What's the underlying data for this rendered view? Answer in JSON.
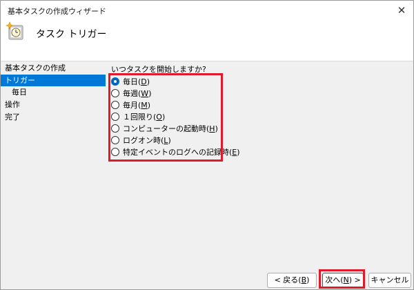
{
  "window": {
    "title": "基本タスクの作成ウィザード",
    "close_glyph": "✕"
  },
  "header": {
    "title": "タスク トリガー",
    "icon": "task-clock-icon"
  },
  "sidebar": {
    "items": [
      {
        "label": "基本タスクの作成",
        "selected": false,
        "sub": false
      },
      {
        "label": "トリガー",
        "selected": true,
        "sub": false
      },
      {
        "label": "毎日",
        "selected": false,
        "sub": true
      },
      {
        "label": "操作",
        "selected": false,
        "sub": false
      },
      {
        "label": "完了",
        "selected": false,
        "sub": false
      }
    ]
  },
  "main": {
    "question": "いつタスクを開始しますか?",
    "options": [
      {
        "text": "毎日",
        "key": "D",
        "checked": true
      },
      {
        "text": "毎週",
        "key": "W",
        "checked": false
      },
      {
        "text": "毎月",
        "key": "M",
        "checked": false
      },
      {
        "text": "１回限り",
        "key": "O",
        "checked": false
      },
      {
        "text": "コンピューターの起動時",
        "key": "H",
        "checked": false
      },
      {
        "text": "ログオン時",
        "key": "L",
        "checked": false
      },
      {
        "text": "特定イベントのログへの記録時",
        "key": "E",
        "checked": false
      }
    ]
  },
  "footer": {
    "back": {
      "pre": "< 戻る(",
      "key": "B",
      "post": ")"
    },
    "next": {
      "pre": "次へ(",
      "key": "N",
      "post": ") >"
    },
    "cancel": "キャンセル"
  },
  "colors": {
    "highlight": "#e21928",
    "selection": "#0078d7",
    "accent": "#0067c0"
  }
}
